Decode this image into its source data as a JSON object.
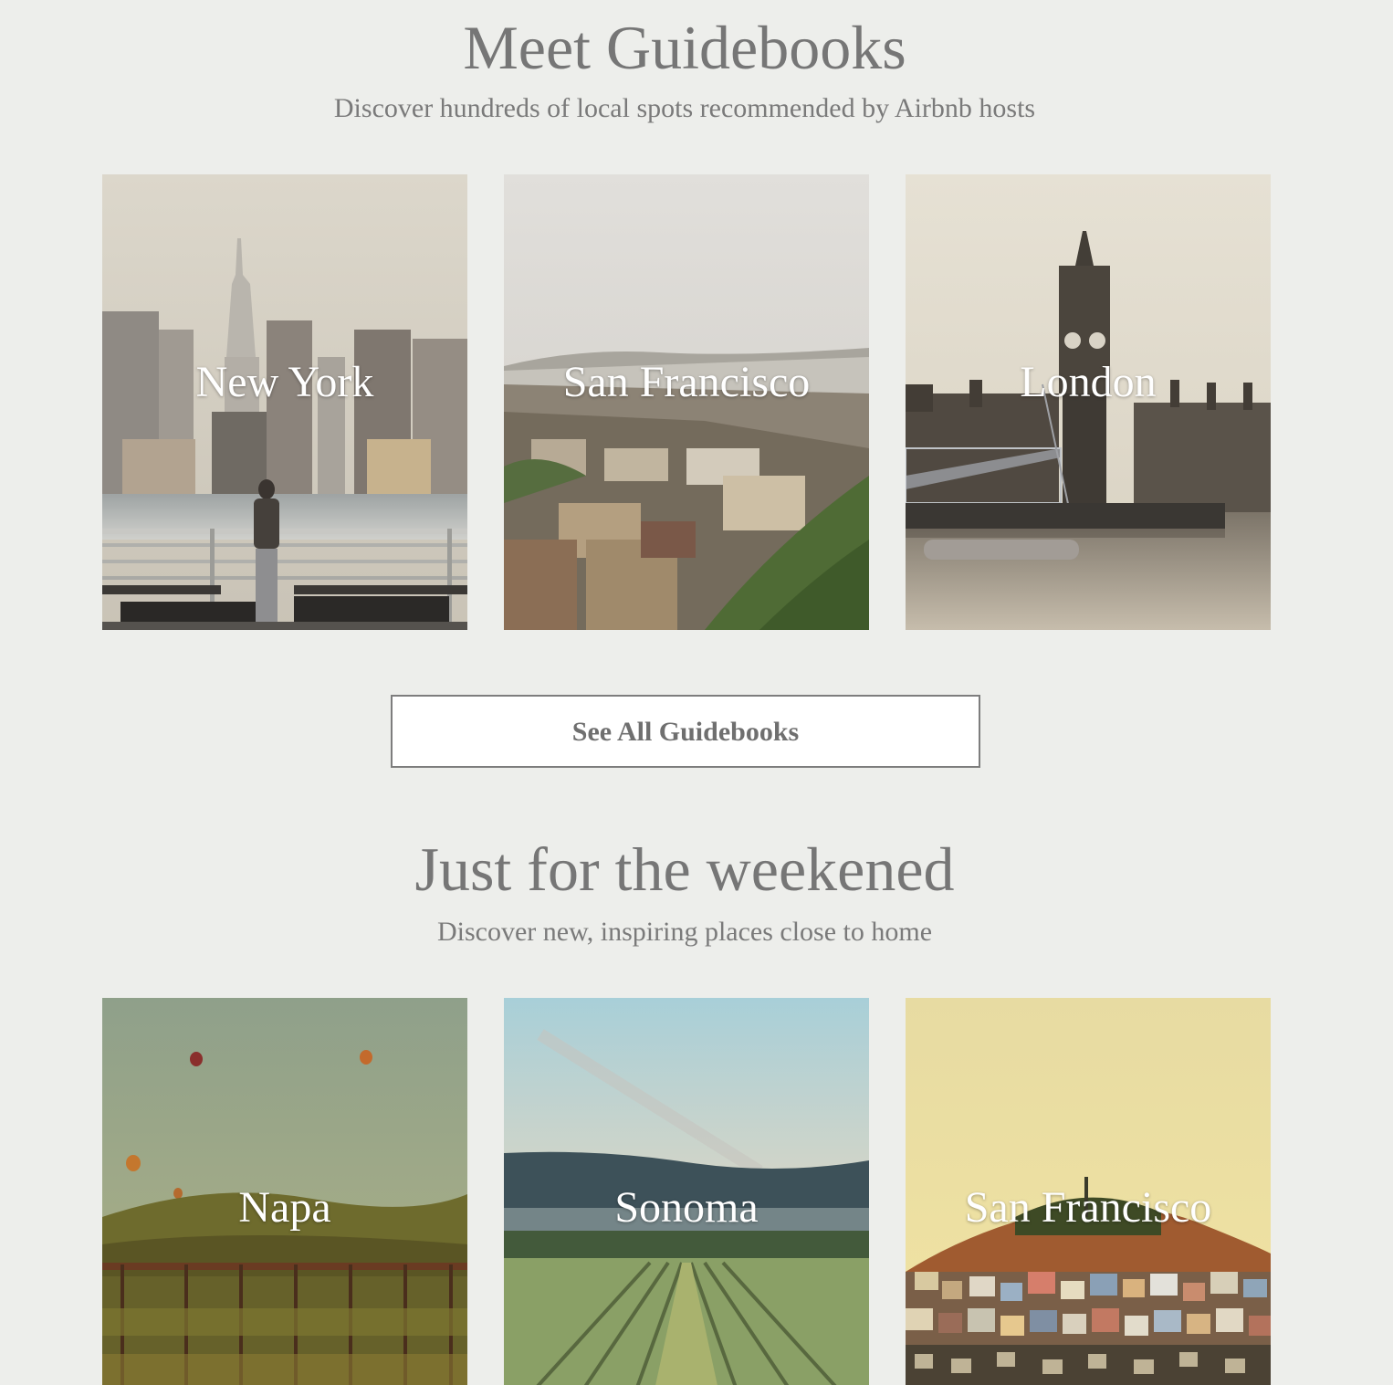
{
  "guidebooks": {
    "title": "Meet Guidebooks",
    "subtitle": "Discover hundreds of local spots recommended by Airbnb hosts",
    "cards": [
      {
        "label": "New York",
        "image": "new-york-skyline-photo"
      },
      {
        "label": "San Francisco",
        "image": "san-francisco-hillside-photo"
      },
      {
        "label": "London",
        "image": "london-big-ben-photo"
      }
    ],
    "see_all_label": "See All Guidebooks"
  },
  "weekend": {
    "title": "Just for the weekened",
    "subtitle": "Discover new, inspiring places close to home",
    "cards": [
      {
        "label": "Napa",
        "image": "napa-vineyard-balloons-photo"
      },
      {
        "label": "Sonoma",
        "image": "sonoma-vineyard-rows-photo"
      },
      {
        "label": "San Francisco",
        "image": "san-francisco-twin-peaks-photo"
      }
    ]
  },
  "colors": {
    "page_background": "#edeeeb",
    "heading_text": "#767676",
    "button_border": "#7d7d7d",
    "card_label": "#ffffff"
  }
}
